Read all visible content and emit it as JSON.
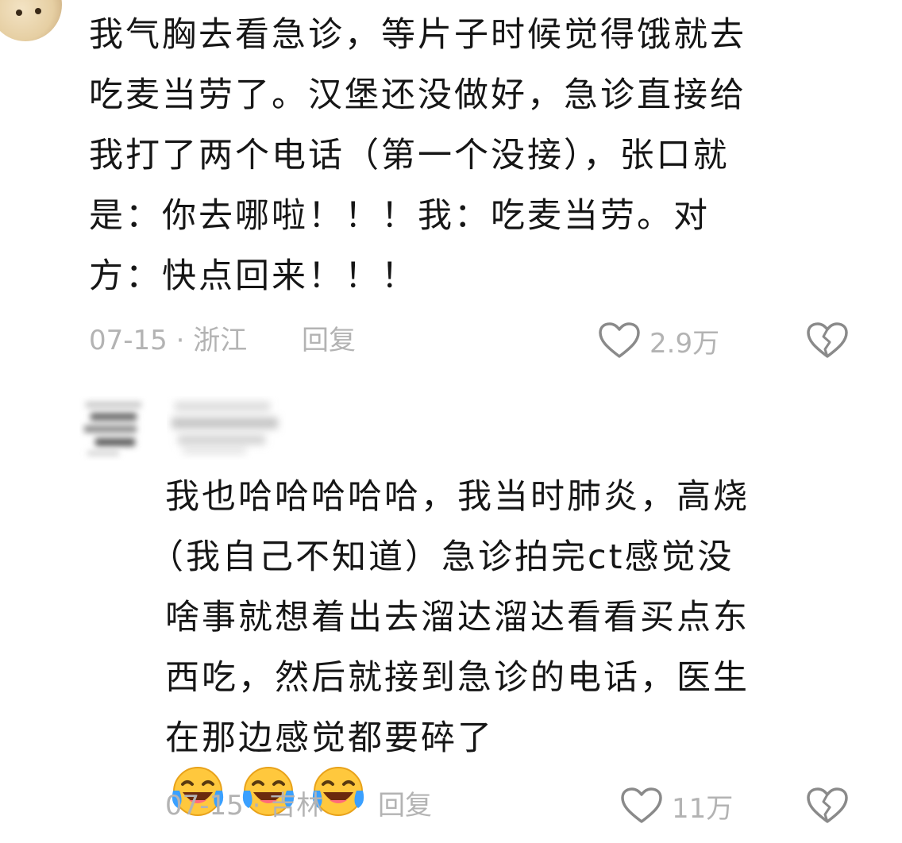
{
  "comments": [
    {
      "lines": [
        "我气胸去看急诊，等片子时候觉得饿就去",
        "吃麦当劳了。汉堡还没做好，急诊直接给",
        "我打了两个电话（第一个没接），张口就",
        "是：你去哪啦！！！我：吃麦当劳。对",
        "方：快点回来！！！"
      ],
      "date_location": "07-15 · 浙江",
      "reply_label": "回复",
      "like_count": "2.9万"
    },
    {
      "lines": [
        "我也哈哈哈哈哈，我当时肺炎，高烧",
        "（我自己不知道）急诊拍完ct感觉没",
        "啥事就想着出去溜达溜达看看买点东",
        "西吃，然后就接到急诊的电话，医生",
        "在那边感觉都要碎了"
      ],
      "emojis": [
        "laughing-crying-emoji",
        "laughing-crying-emoji",
        "laughing-crying-emoji"
      ],
      "date_location": "07-15 · 吉林",
      "reply_label": "回复",
      "like_count": "11万"
    }
  ],
  "icons": {
    "like": "heart-outline-icon",
    "dislike": "broken-heart-icon"
  },
  "colors": {
    "text": "#161616",
    "meta": "#b3b3b3",
    "emoji_face": "#ffc83d",
    "emoji_tear": "#3aa0ff"
  }
}
